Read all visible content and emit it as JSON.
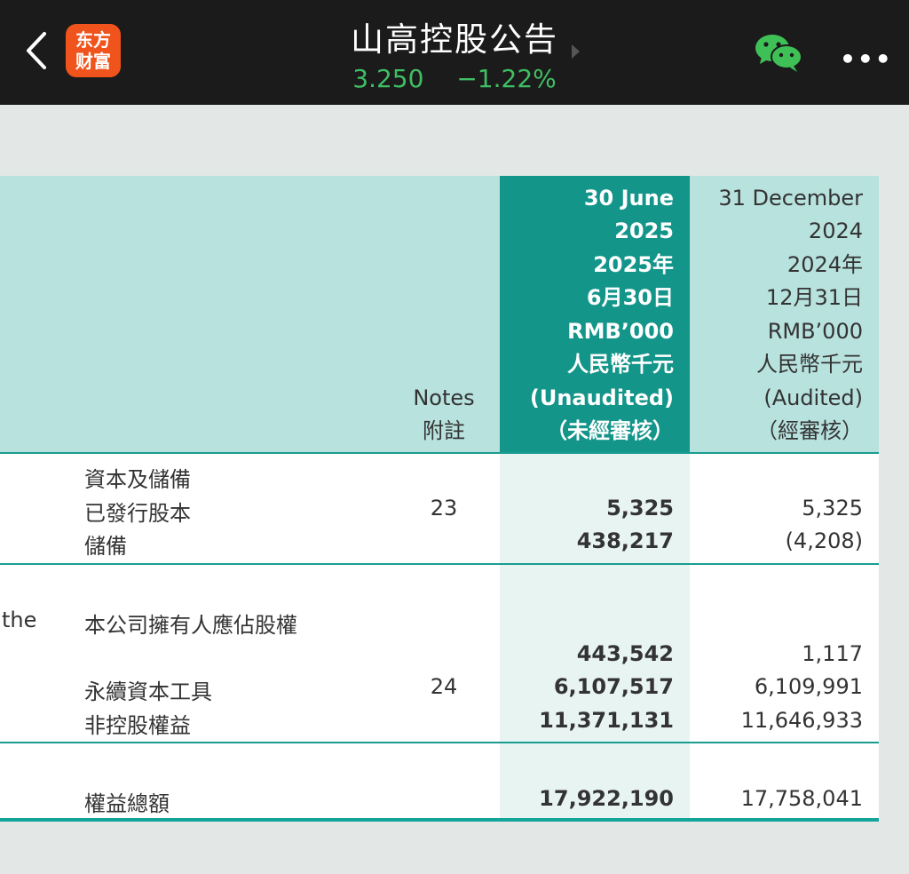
{
  "app": {
    "title": "山高控股公告",
    "price": "3.250",
    "change": "−1.22%",
    "logo_line1": "东方",
    "logo_line2": "财富",
    "more_label": "•••",
    "icons": [
      "back-arrow-icon",
      "wechat-icon",
      "more-icon",
      "play-icon"
    ]
  },
  "table": {
    "notes_header": [
      "Notes",
      "附註"
    ],
    "current_header": [
      "30 June",
      "2025",
      "2025年",
      "6月30日",
      "RMB’000",
      "人民幣千元",
      "(Unaudited)",
      "（未經審核）"
    ],
    "prior_header": [
      "31 December",
      "2024",
      "2024年",
      "12月31日",
      "RMB’000",
      "人民幣千元",
      "(Audited)",
      "（經審核）"
    ],
    "rows": [
      {
        "left": "",
        "label": "資本及儲備",
        "note": "",
        "cur": "",
        "prev": ""
      },
      {
        "left": "",
        "label": "已發行股本",
        "note": "23",
        "cur": "5,325",
        "prev": "5,325"
      },
      {
        "left": "",
        "label": "儲備",
        "note": "",
        "cur": "438,217",
        "prev": "(4,208)"
      },
      {
        "left": "the",
        "label": "本公司擁有人應佔股權",
        "note": "",
        "cur": "",
        "prev": ""
      },
      {
        "left": "",
        "label": "",
        "note": "",
        "cur": "443,542",
        "prev": "1,117"
      },
      {
        "left": "",
        "label": "永續資本工具",
        "note": "24",
        "cur": "6,107,517",
        "prev": "6,109,991"
      },
      {
        "left": "",
        "label": "非控股權益",
        "note": "",
        "cur": "11,371,131",
        "prev": "11,646,933"
      },
      {
        "left": "",
        "label": "權益總額",
        "note": "",
        "cur": "17,922,190",
        "prev": "17,758,041"
      }
    ]
  },
  "colors": {
    "accent": "#13958a",
    "header_band": "#b8e2de",
    "price_green": "#3fbf64",
    "logo": "#f0541c"
  }
}
